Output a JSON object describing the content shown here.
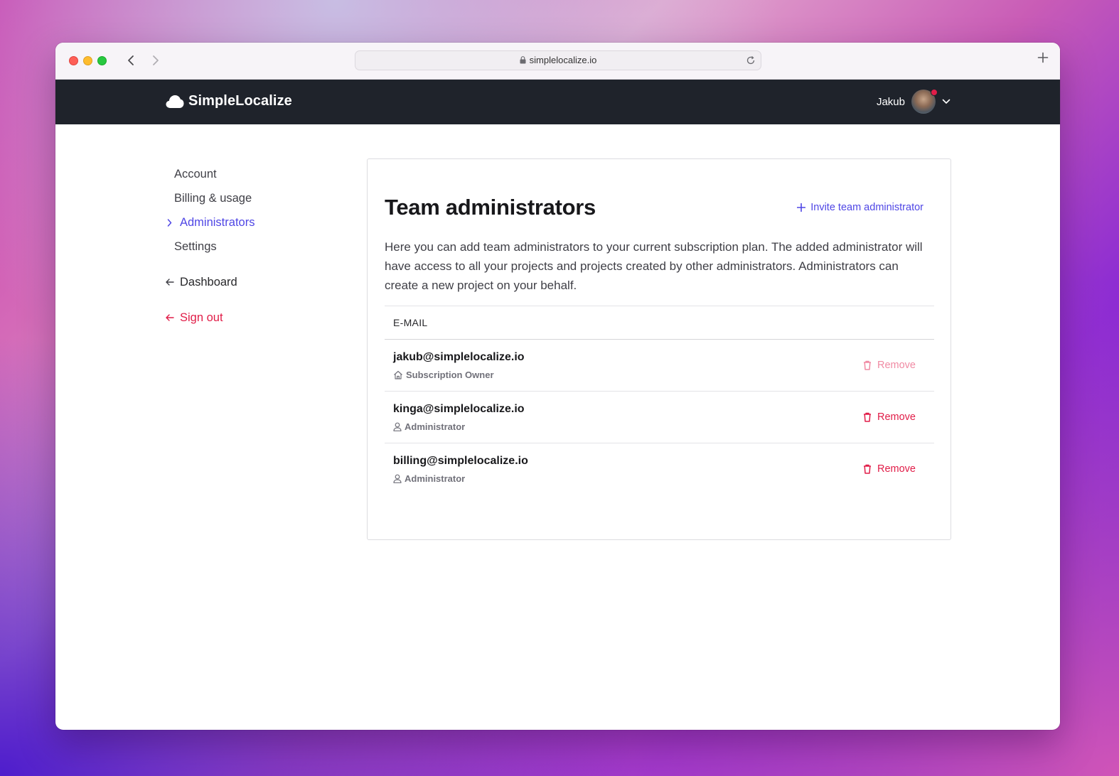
{
  "browser": {
    "url": "simplelocalize.io"
  },
  "header": {
    "brand": "SimpleLocalize",
    "user_name": "Jakub"
  },
  "sidebar": {
    "items": [
      {
        "label": "Account"
      },
      {
        "label": "Billing & usage"
      },
      {
        "label": "Administrators"
      },
      {
        "label": "Settings"
      }
    ],
    "dashboard_label": "Dashboard",
    "signout_label": "Sign out"
  },
  "main": {
    "title": "Team administrators",
    "invite_label": "Invite team administrator",
    "description": "Here you can add team administrators to your current subscription plan. The added administrator will have access to all your projects and projects created by other administrators. Administrators can create a new project on your behalf.",
    "column_header": "E-MAIL",
    "rows": [
      {
        "email": "jakub@simplelocalize.io",
        "role": "Subscription Owner",
        "action": "Remove"
      },
      {
        "email": "kinga@simplelocalize.io",
        "role": "Administrator",
        "action": "Remove"
      },
      {
        "email": "billing@simplelocalize.io",
        "role": "Administrator",
        "action": "Remove"
      }
    ]
  },
  "colors": {
    "accent": "#4f46e5",
    "danger": "#e11d48",
    "header_bg": "#1f232b"
  },
  "icons": {
    "nav_active": "chevron-right-icon",
    "back": "arrow-left-icon",
    "invite": "plus-icon",
    "owner_role": "home-icon",
    "admin_role": "user-icon",
    "remove": "trash-icon"
  }
}
